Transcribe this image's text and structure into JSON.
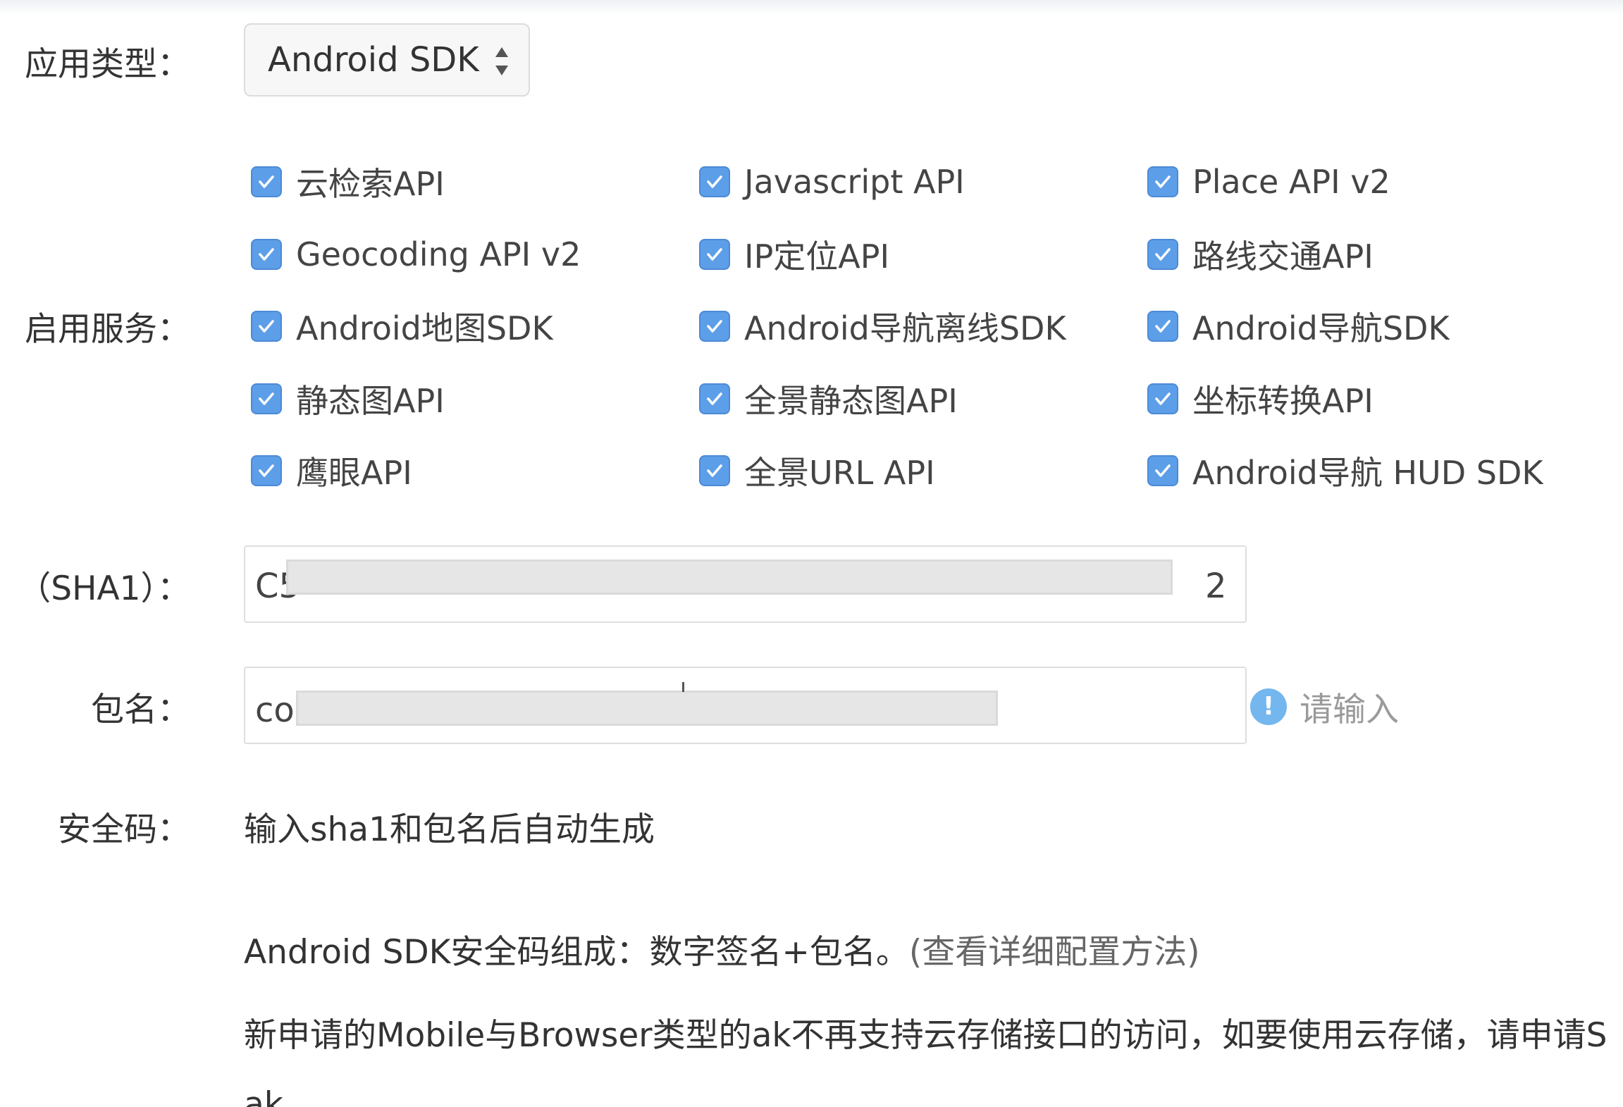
{
  "form": {
    "app_type": {
      "label": "应用类型：",
      "selected": "Android SDK"
    },
    "services": {
      "label": "启用服务：",
      "items": [
        {
          "label": "云检索API",
          "checked": true
        },
        {
          "label": "Javascript API",
          "checked": true
        },
        {
          "label": "Place API v2",
          "checked": true
        },
        {
          "label": "Geocoding API v2",
          "checked": true
        },
        {
          "label": "IP定位API",
          "checked": true
        },
        {
          "label": "路线交通API",
          "checked": true
        },
        {
          "label": "Android地图SDK",
          "checked": true
        },
        {
          "label": "Android导航离线SDK",
          "checked": true
        },
        {
          "label": "Android导航SDK",
          "checked": true
        },
        {
          "label": "静态图API",
          "checked": true
        },
        {
          "label": "全景静态图API",
          "checked": true
        },
        {
          "label": "坐标转换API",
          "checked": true
        },
        {
          "label": "鹰眼API",
          "checked": true
        },
        {
          "label": "全景URL API",
          "checked": true
        },
        {
          "label": "Android导航 HUD SDK",
          "checked": true
        }
      ]
    },
    "sha1": {
      "label": "（SHA1）：",
      "value_start": "C5",
      "value_end": "2"
    },
    "package": {
      "label": "包名：",
      "value_start": "co",
      "hint": "请输入"
    },
    "security_code": {
      "label": "安全码：",
      "value": "输入sha1和包名后自动生成"
    },
    "notes": {
      "composition": "Android SDK安全码组成：数字签名+包名。",
      "config_link": "(查看详细配置方法)",
      "storage_note": "新申请的Mobile与Browser类型的ak不再支持云存储接口的访问，如要使用云存储，请申请S",
      "storage_note_end": "ak。"
    }
  },
  "colors": {
    "checkbox": "#5d9ee8",
    "hint_icon": "#74b6ee",
    "hint_text": "#9a9a9a"
  }
}
